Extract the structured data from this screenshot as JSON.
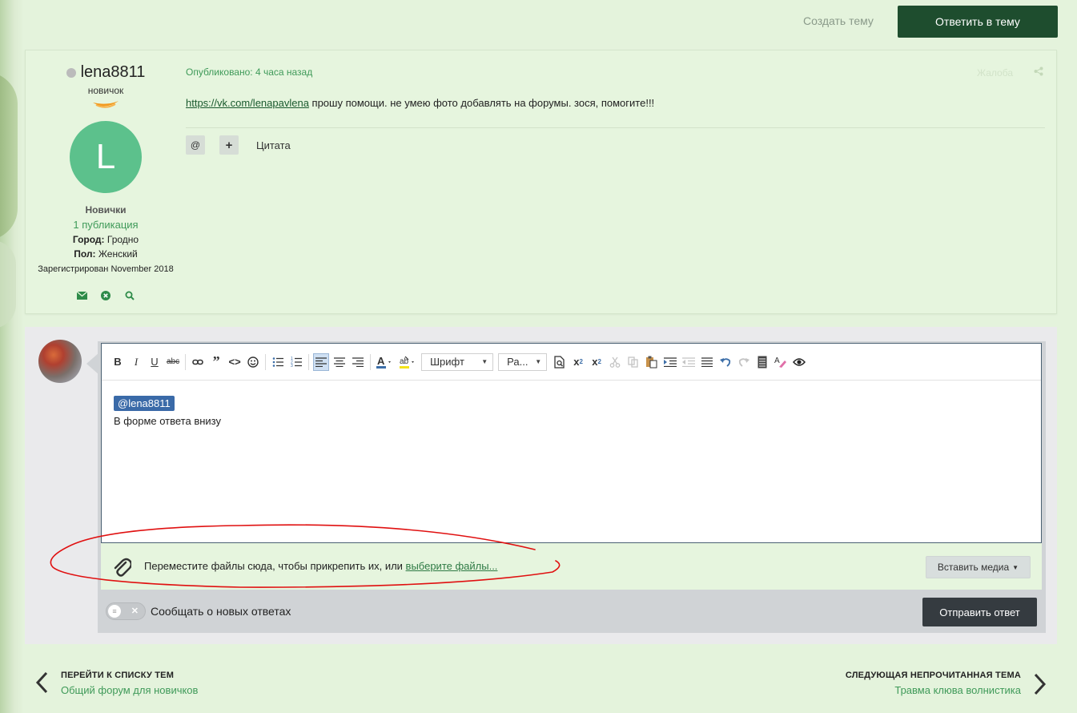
{
  "topbar": {
    "create_topic": "Создать тему",
    "reply_topic": "Ответить в тему"
  },
  "post": {
    "author": {
      "name": "lena8811",
      "rank": "новичок",
      "avatar_letter": "L",
      "group": "Новички",
      "posts": "1 публикация",
      "city_label": "Город:",
      "city": "Гродно",
      "gender_label": "Пол:",
      "gender": "Женский",
      "registered": "Зарегистрирован November 2018"
    },
    "published": "Опубликовано: 4 часа назад",
    "report": "Жалоба",
    "link": "https://vk.com/lenapavlena",
    "text": " прошу помощи. не умею фото добавлять на форумы. зося, помогите!!!",
    "mention_btn": "@",
    "plus_btn": "+",
    "quote": "Цитата"
  },
  "editor": {
    "font_combo": "Шрифт",
    "size_combo": "Ра...",
    "mention": "@lena8811",
    "body": "В форме ответа внизу",
    "attach_text": "Переместите файлы сюда, чтобы прикрепить их, или ",
    "attach_link": "выберите файлы...",
    "insert_media": "Вставить медиа",
    "notify_label": "Сообщать о новых ответах",
    "submit": "Отправить ответ"
  },
  "nav": {
    "prev_label": "ПЕРЕЙТИ К СПИСКУ ТЕМ",
    "prev_link": "Общий форум для новичков",
    "next_label": "СЛЕДУЮЩАЯ НЕПРОЧИТАННАЯ ТЕМА",
    "next_link": "Травма клюва волнистика"
  },
  "colors": {
    "accent_dark_green": "#1e4d2e",
    "link_green": "#3f9a59",
    "annotation_red": "#e01010"
  }
}
